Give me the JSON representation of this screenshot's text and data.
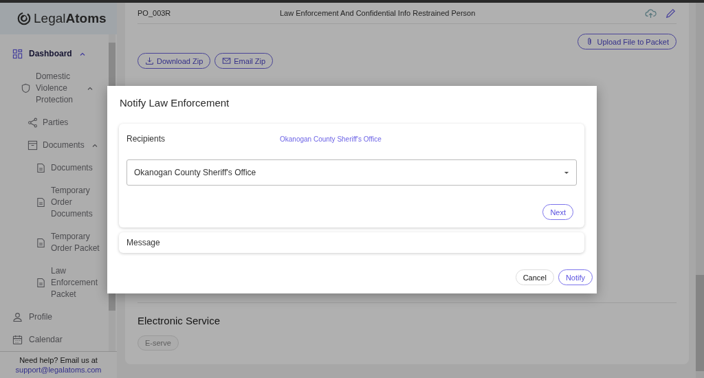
{
  "sidebar": {
    "logo": {
      "light": "Legal",
      "bold": "Atoms"
    },
    "dashboard": {
      "label": "Dashboard",
      "selected": true,
      "expanded": true
    },
    "case": {
      "label": "Domestic Violence Protection",
      "expanded": true
    },
    "parties": {
      "label": "Parties"
    },
    "documents": {
      "label": "Documents",
      "expanded": true,
      "children": [
        {
          "label": "Documents"
        },
        {
          "label": "Temporary Order Documents"
        },
        {
          "label": "Temporary Order Packet"
        },
        {
          "label": "Law Enforcement Packet"
        }
      ]
    },
    "profile": {
      "label": "Profile"
    },
    "calendar": {
      "label": "Calendar"
    },
    "help": {
      "text": "Need help? Email us at",
      "email": "support@legalatoms.com"
    }
  },
  "packet": {
    "code": "PO_003R",
    "title": "Law Enforcement And Confidential Info Restrained Person",
    "upload_button": "Upload File to Packet",
    "download_button": "Download Zip",
    "email_button": "Email Zip"
  },
  "electronic_service": {
    "title": "Electronic Service",
    "button": "E-serve"
  },
  "modal": {
    "title": "Notify Law Enforcement",
    "recipients": {
      "label": "Recipients",
      "summary": "Okanogan County Sheriff's Office",
      "dropdown_value": "Okanogan County Sheriff's Office",
      "next_button": "Next"
    },
    "message": {
      "label": "Message"
    },
    "cancel_button": "Cancel",
    "notify_button": "Notify"
  }
}
